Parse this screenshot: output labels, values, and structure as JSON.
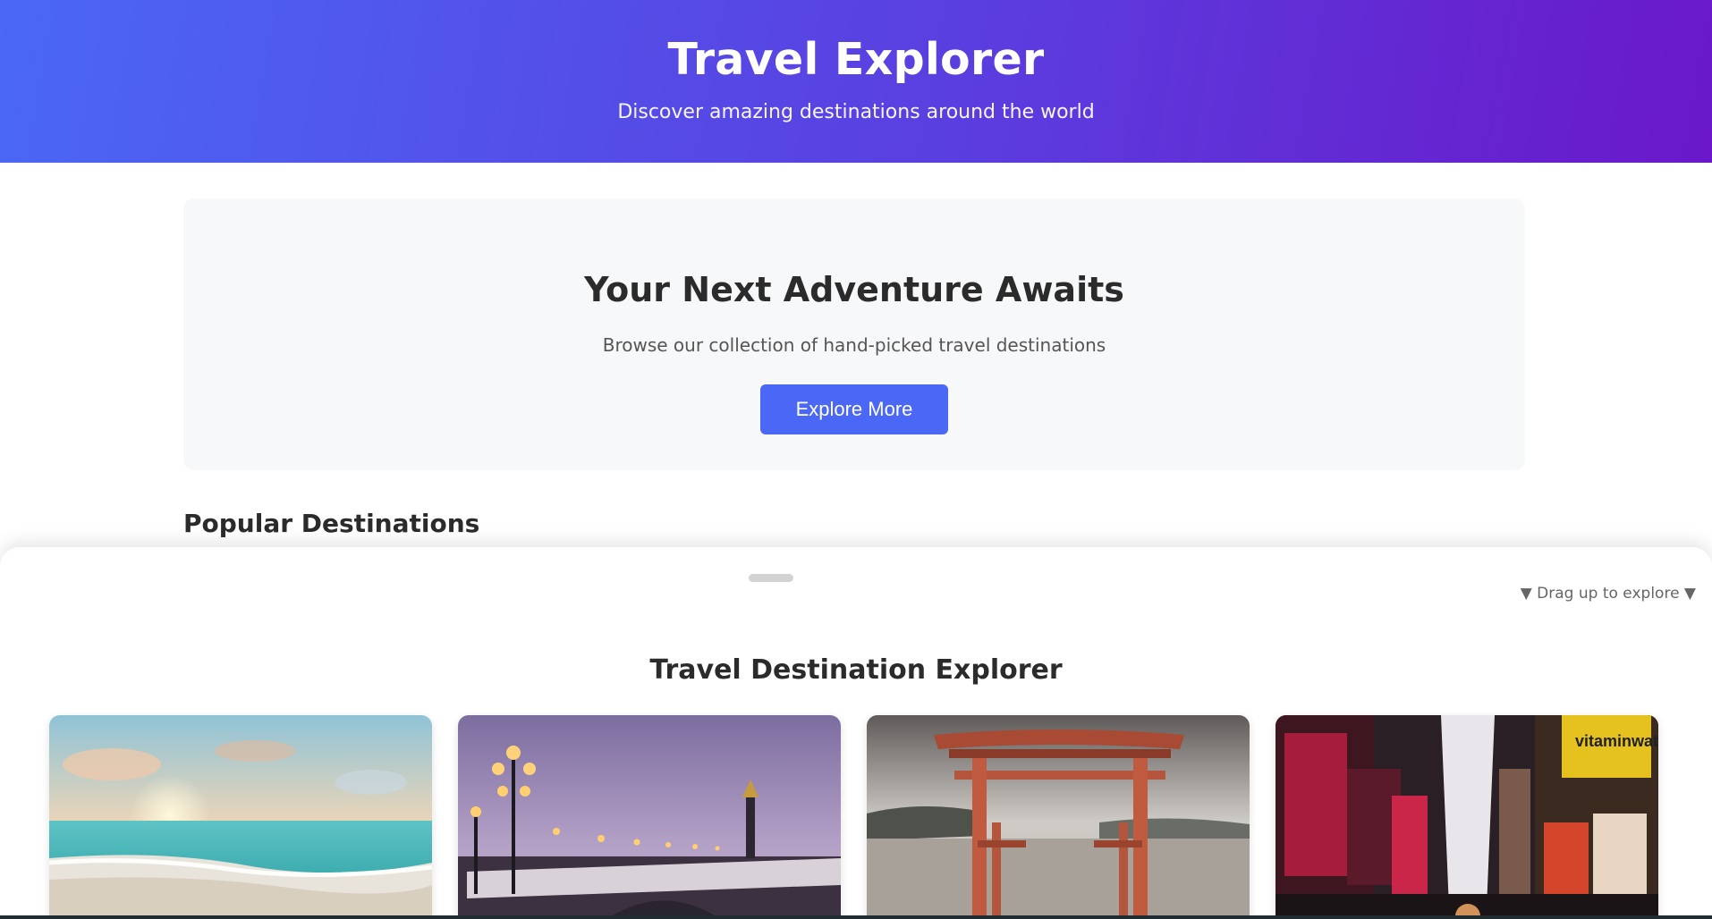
{
  "header": {
    "title": "Travel Explorer",
    "subtitle": "Discover amazing destinations around the world"
  },
  "hero": {
    "title": "Your Next Adventure Awaits",
    "text": "Browse our collection of hand-picked travel destinations",
    "button_label": "Explore More"
  },
  "section": {
    "heading": "Popular Destinations"
  },
  "sheet": {
    "drag_hint": "▼ Drag up to explore ▼",
    "title": "Travel Destination Explorer",
    "cards": [
      {
        "image": "beach-sunset-image"
      },
      {
        "image": "paris-bridge-image"
      },
      {
        "image": "japan-torii-gate-image"
      },
      {
        "image": "times-square-image"
      }
    ],
    "card_sign_text": "vitaminwater zero"
  },
  "colors": {
    "accent": "#4a67f5",
    "header_gradient_start": "#4a67f5",
    "header_gradient_end": "#6a18c9",
    "hero_bg": "#f7f8fa"
  }
}
